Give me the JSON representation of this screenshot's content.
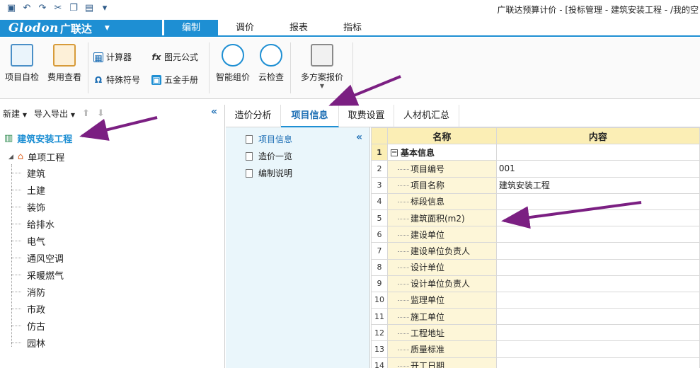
{
  "title_bar": {
    "window_title": "广联达预算计价 - [投标管理 - 建筑安装工程 - /我的空",
    "quick_access": [
      "save-icon",
      "undo-icon",
      "redo-icon",
      "cut-icon",
      "copy-icon",
      "paste-icon",
      "customize-icon"
    ]
  },
  "menu": {
    "logo_latin": "Glodon",
    "logo_cn": "广联达",
    "tabs": [
      "编制",
      "调价",
      "报表",
      "指标"
    ],
    "active_tab": "编制"
  },
  "ribbon": {
    "project_check": "项目自检",
    "fee_view": "费用查看",
    "calculator": "计算器",
    "formula": "图元公式",
    "special_symbol": "特殊符号",
    "hardware_manual": "五金手册",
    "smart_pricing": "智能组价",
    "cloud_check": "云检查",
    "multi_plan": "多方案报价"
  },
  "left_panel": {
    "toolbar": {
      "new": "新建",
      "import_export": "导入导出"
    },
    "root": "建筑安装工程",
    "sub": "单项工程",
    "leaves": [
      "建筑",
      "土建",
      "装饰",
      "给排水",
      "电气",
      "通风空调",
      "采暖燃气",
      "消防",
      "市政",
      "仿古",
      "园林"
    ]
  },
  "sub_tabs": [
    "造价分析",
    "项目信息",
    "取费设置",
    "人材机汇总"
  ],
  "active_sub_tab": "项目信息",
  "nav_items": [
    "项目信息",
    "造价一览",
    "编制说明"
  ],
  "grid": {
    "headers": {
      "name": "名称",
      "content": "内容"
    },
    "rows": [
      {
        "num": "1",
        "name": "基本信息",
        "content": "",
        "group": true
      },
      {
        "num": "2",
        "name": "项目编号",
        "content": "001"
      },
      {
        "num": "3",
        "name": "项目名称",
        "content": "建筑安装工程"
      },
      {
        "num": "4",
        "name": "标段信息",
        "content": ""
      },
      {
        "num": "5",
        "name": "建筑面积(m2)",
        "content": ""
      },
      {
        "num": "6",
        "name": "建设单位",
        "content": ""
      },
      {
        "num": "7",
        "name": "建设单位负责人",
        "content": ""
      },
      {
        "num": "8",
        "name": "设计单位",
        "content": ""
      },
      {
        "num": "9",
        "name": "设计单位负责人",
        "content": ""
      },
      {
        "num": "10",
        "name": "监理单位",
        "content": ""
      },
      {
        "num": "11",
        "name": "施工单位",
        "content": ""
      },
      {
        "num": "12",
        "name": "工程地址",
        "content": ""
      },
      {
        "num": "13",
        "name": "质量标准",
        "content": ""
      },
      {
        "num": "14",
        "name": "开工日期",
        "content": ""
      }
    ]
  },
  "colors": {
    "accent": "#1e8fd3",
    "annotation": "#7b1f82",
    "header_bg": "#fbeeb5"
  }
}
